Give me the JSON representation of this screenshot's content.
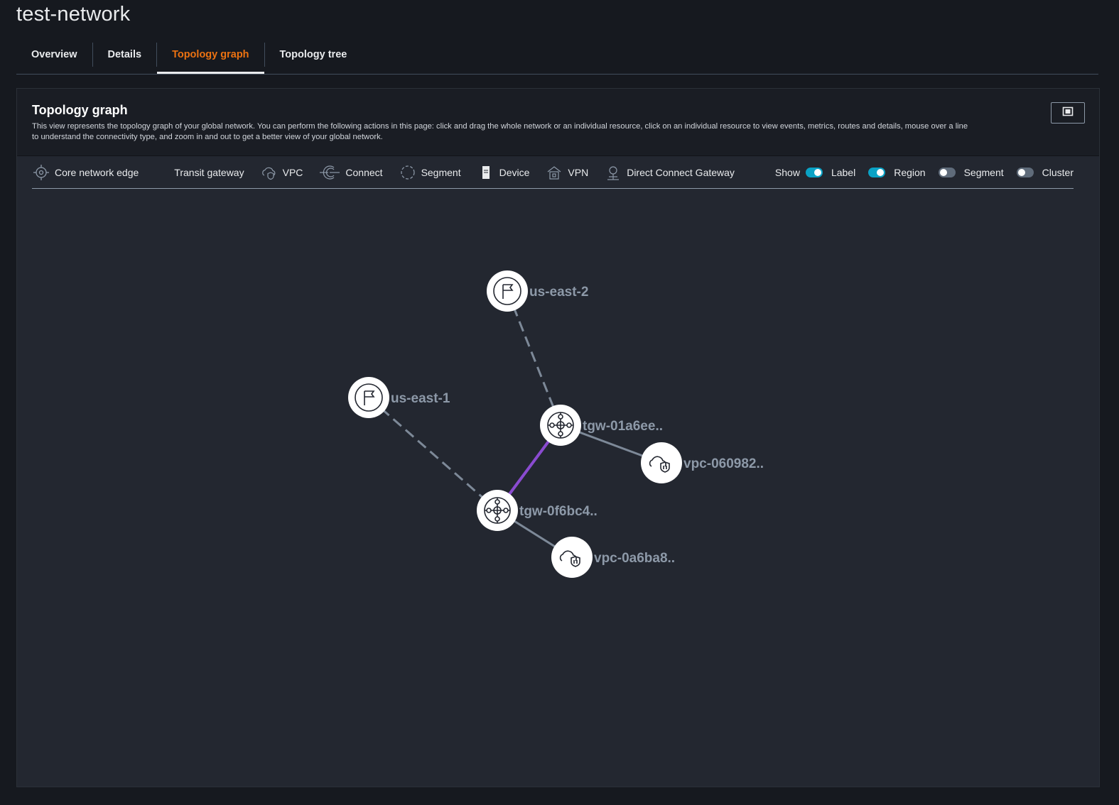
{
  "page": {
    "title": "test-network"
  },
  "tabs": [
    {
      "label": "Overview",
      "active": false
    },
    {
      "label": "Details",
      "active": false
    },
    {
      "label": "Topology graph",
      "active": true
    },
    {
      "label": "Topology tree",
      "active": false
    }
  ],
  "panel": {
    "title": "Topology graph",
    "description": "This view represents the topology graph of your global network. You can perform the following actions in this page: click and drag the whole network or an individual resource, click on an individual resource to view events, metrics, routes and details, mouse over a line to understand the connectivity type, and zoom in and out to get a better view of your global network.",
    "fullscreen_icon": "fullscreen-icon"
  },
  "legend": [
    {
      "label": "Core network edge",
      "icon": "core-network-edge-icon"
    },
    {
      "label": "Transit gateway",
      "icon": "transit-gateway-icon"
    },
    {
      "label": "VPC",
      "icon": "vpc-icon"
    },
    {
      "label": "Connect",
      "icon": "connect-icon"
    },
    {
      "label": "Segment",
      "icon": "segment-icon"
    },
    {
      "label": "Device",
      "icon": "device-icon"
    },
    {
      "label": "VPN",
      "icon": "vpn-icon"
    },
    {
      "label": "Direct Connect Gateway",
      "icon": "direct-connect-gateway-icon"
    }
  ],
  "show": {
    "label": "Show",
    "toggles": [
      {
        "label": "Label",
        "on": true
      },
      {
        "label": "Region",
        "on": true
      },
      {
        "label": "Segment",
        "on": false
      },
      {
        "label": "Cluster",
        "on": false
      }
    ]
  },
  "graph": {
    "colors": {
      "link": "#7d8998",
      "peering": "#8a4bd0",
      "node_fill": "#ffffff"
    },
    "nodes": [
      {
        "id": "us-east-2",
        "label": "us-east-2",
        "type": "region"
      },
      {
        "id": "us-east-1",
        "label": "us-east-1",
        "type": "region"
      },
      {
        "id": "tgw-01a6ee",
        "label": "tgw-01a6ee..",
        "type": "transit-gateway"
      },
      {
        "id": "tgw-0f6bc4",
        "label": "tgw-0f6bc4..",
        "type": "transit-gateway"
      },
      {
        "id": "vpc-060982",
        "label": "vpc-060982..",
        "type": "vpc"
      },
      {
        "id": "vpc-0a6ba8",
        "label": "vpc-0a6ba8..",
        "type": "vpc"
      }
    ],
    "links": [
      {
        "from": "us-east-2",
        "to": "tgw-01a6ee",
        "style": "dashed"
      },
      {
        "from": "us-east-1",
        "to": "tgw-0f6bc4",
        "style": "dashed"
      },
      {
        "from": "tgw-01a6ee",
        "to": "tgw-0f6bc4",
        "style": "peering"
      },
      {
        "from": "tgw-01a6ee",
        "to": "vpc-060982",
        "style": "solid"
      },
      {
        "from": "tgw-0f6bc4",
        "to": "vpc-0a6ba8",
        "style": "solid"
      }
    ]
  }
}
